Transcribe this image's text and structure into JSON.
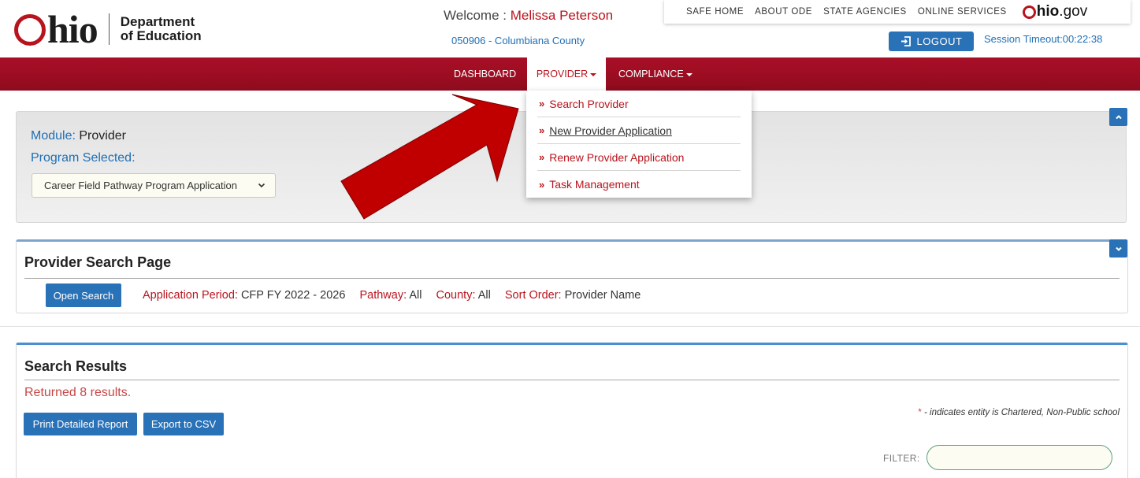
{
  "header": {
    "logo_word": "hio",
    "logo_dept_line1": "Department",
    "logo_dept_line2": "of Education",
    "welcome_prefix": "Welcome : ",
    "welcome_name": "Melissa Peterson",
    "district": "050906 - Columbiana County",
    "top_links": [
      "SAFE HOME",
      "ABOUT ODE",
      "STATE AGENCIES",
      "ONLINE SERVICES"
    ],
    "ohio_gov_brand": "hio",
    "ohio_gov_suffix": ".gov",
    "logout_label": "LOGOUT",
    "session_timeout": "Session Timeout:00:22:38"
  },
  "nav": {
    "dashboard": "DASHBOARD",
    "provider": "PROVIDER",
    "compliance": "COMPLIANCE"
  },
  "provider_menu": {
    "items": [
      "Search Provider",
      "New Provider Application",
      "Renew Provider Application",
      "Task Management"
    ]
  },
  "module_panel": {
    "module_label": "Module:",
    "module_value": "Provider",
    "program_label": "Program Selected:",
    "program_selected": "Career Field Pathway Program Application"
  },
  "search_panel": {
    "title": "Provider Search Page",
    "open_search_label": "Open Search",
    "criteria": [
      {
        "label": "Application Period:",
        "value": "CFP FY 2022 - 2026"
      },
      {
        "label": "Pathway:",
        "value": "All"
      },
      {
        "label": "County:",
        "value": "All"
      },
      {
        "label": "Sort Order:",
        "value": "Provider Name"
      }
    ]
  },
  "results_panel": {
    "title": "Search Results",
    "count_text": "Returned 8 results.",
    "print_label": "Print Detailed Report",
    "export_label": "Export to CSV",
    "legend_star": "*",
    "legend_text": " - indicates entity is Chartered, Non-Public school",
    "filter_label": "FILTER:",
    "filter_value": ""
  },
  "colors": {
    "brand_red": "#b9131d",
    "nav_red": "#9c0d22",
    "accent_blue": "#2a72b7",
    "link_blue": "#1f6fb5",
    "annotation_arrow": "#c00000"
  }
}
